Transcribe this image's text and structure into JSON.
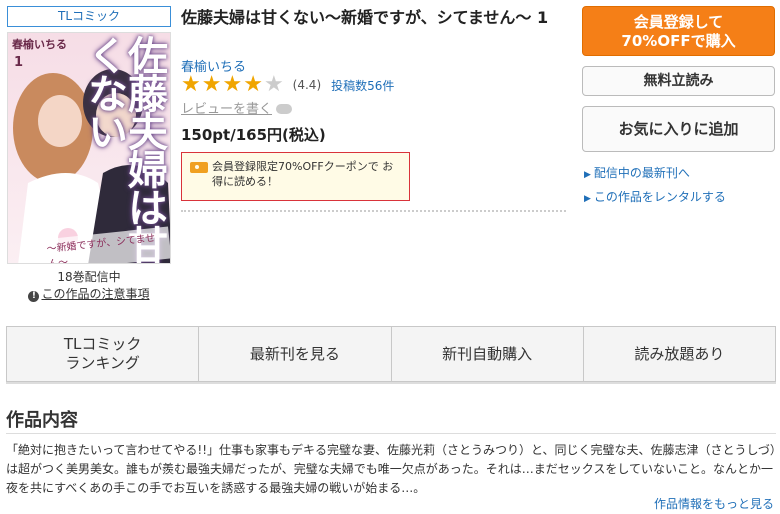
{
  "genre_tag": "TLコミック",
  "cover": {
    "author": "春榆いちる",
    "volume": "1",
    "title": "佐藤夫婦は甘くない",
    "subtitle": "〜新婚ですが、シてません〜"
  },
  "distribution": "18巻配信中",
  "notice_link": "この作品の注意事項",
  "title": "佐藤夫婦は甘くない〜新婚ですが、シてません〜 1",
  "author": "春榆いちる",
  "rating": {
    "stars": 4,
    "max": 5,
    "value": "(4.4)",
    "count": "投稿数56件"
  },
  "write_review": "レビューを書く",
  "price": "150pt/165円(税込)",
  "coupon": "会員登録限定70%OFFクーポンで お得に読める！",
  "buttons": {
    "register_line1": "会員登録して",
    "register_line2": "70%OFFで購入",
    "trial": "無料立読み",
    "favorite": "お気に入りに追加"
  },
  "side_links": [
    "配信中の最新刊へ",
    "この作品をレンタルする"
  ],
  "tabs": [
    {
      "line1": "TLコミック",
      "line2": "ランキング"
    },
    {
      "line1": "最新刊を見る",
      "line2": ""
    },
    {
      "line1": "新刊自動購入",
      "line2": ""
    },
    {
      "line1": "読み放題あり",
      "line2": ""
    }
  ],
  "section_title": "作品内容",
  "synopsis": "「絶対に抱きたいって言わせてやる!!」仕事も家事もデキる完璧な妻、佐藤光莉（さとうみつり）と、同じく完璧な夫、佐藤志津（さとうしづ）は超がつく美男美女。誰もが羨む最強夫婦だったが、完璧な夫婦でも唯一欠点があった。それは…まだセックスをしていないこと。なんとか一夜を共にすべくあの手この手でお互いを誘惑する最強夫婦の戦いが始まる…。",
  "more_link": "作品情報をもっと見る",
  "colors": {
    "accent": "#f57f17",
    "link": "#1f6fb8",
    "coupon_border": "#d9333a",
    "star": "#f0a500"
  }
}
